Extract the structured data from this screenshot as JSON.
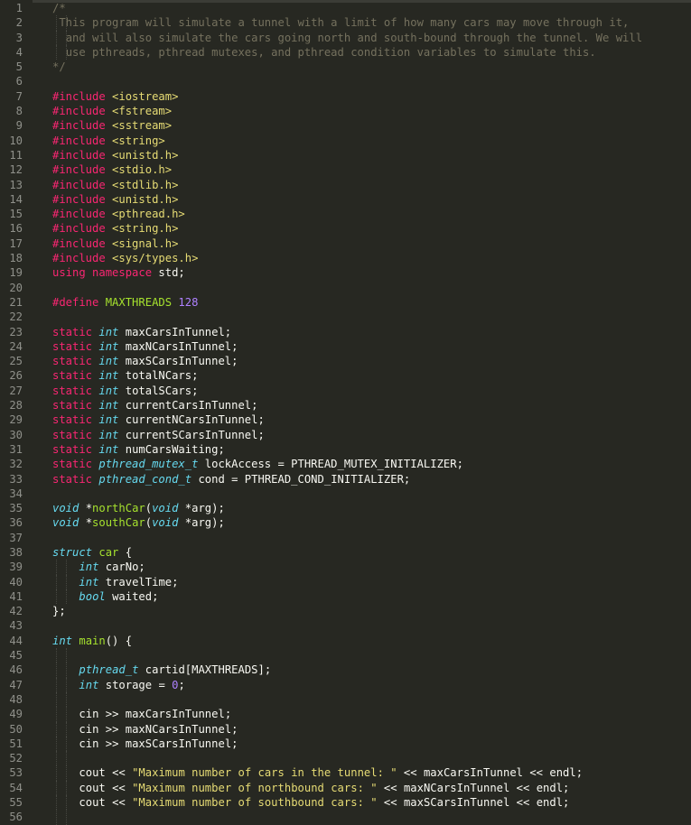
{
  "editor": {
    "theme_colors": {
      "background": "#272822",
      "comment": "#75715e",
      "keyword": "#f92672",
      "type": "#66d9ef",
      "function": "#a6e22e",
      "number": "#ae81ff",
      "string": "#e6db74",
      "text": "#f8f8f2",
      "line_number": "#8f908a"
    },
    "lines": [
      {
        "n": "1",
        "indent": 0,
        "tokens": [
          {
            "c": "comment",
            "t": "/*"
          }
        ]
      },
      {
        "n": "2",
        "indent": 1,
        "tokens": [
          {
            "c": "comment",
            "t": "This program will simulate a tunnel with a limit of how many cars may move through it,"
          }
        ]
      },
      {
        "n": "3",
        "indent": 2,
        "tokens": [
          {
            "c": "comment",
            "t": "and will also simulate the cars going north and south-bound through the tunnel. We will"
          }
        ]
      },
      {
        "n": "4",
        "indent": 2,
        "tokens": [
          {
            "c": "comment",
            "t": "use pthreads, pthread mutexes, and pthread condition variables to simulate this."
          }
        ]
      },
      {
        "n": "5",
        "indent": 0,
        "tokens": [
          {
            "c": "comment",
            "t": "*/"
          }
        ]
      },
      {
        "n": "6",
        "indent": 0,
        "tokens": []
      },
      {
        "n": "7",
        "indent": 0,
        "tokens": [
          {
            "c": "pre",
            "t": "#include "
          },
          {
            "c": "inc",
            "t": "<iostream>"
          }
        ]
      },
      {
        "n": "8",
        "indent": 0,
        "tokens": [
          {
            "c": "pre",
            "t": "#include "
          },
          {
            "c": "inc",
            "t": "<fstream>"
          }
        ]
      },
      {
        "n": "9",
        "indent": 0,
        "tokens": [
          {
            "c": "pre",
            "t": "#include "
          },
          {
            "c": "inc",
            "t": "<sstream>"
          }
        ]
      },
      {
        "n": "10",
        "indent": 0,
        "tokens": [
          {
            "c": "pre",
            "t": "#include "
          },
          {
            "c": "inc",
            "t": "<string>"
          }
        ]
      },
      {
        "n": "11",
        "indent": 0,
        "tokens": [
          {
            "c": "pre",
            "t": "#include "
          },
          {
            "c": "inc",
            "t": "<unistd.h>"
          }
        ]
      },
      {
        "n": "12",
        "indent": 0,
        "tokens": [
          {
            "c": "pre",
            "t": "#include "
          },
          {
            "c": "inc",
            "t": "<stdio.h>"
          }
        ]
      },
      {
        "n": "13",
        "indent": 0,
        "tokens": [
          {
            "c": "pre",
            "t": "#include "
          },
          {
            "c": "inc",
            "t": "<stdlib.h>"
          }
        ]
      },
      {
        "n": "14",
        "indent": 0,
        "tokens": [
          {
            "c": "pre",
            "t": "#include "
          },
          {
            "c": "inc",
            "t": "<unistd.h>"
          }
        ]
      },
      {
        "n": "15",
        "indent": 0,
        "tokens": [
          {
            "c": "pre",
            "t": "#include "
          },
          {
            "c": "inc",
            "t": "<pthread.h>"
          }
        ]
      },
      {
        "n": "16",
        "indent": 0,
        "tokens": [
          {
            "c": "pre",
            "t": "#include "
          },
          {
            "c": "inc",
            "t": "<string.h>"
          }
        ]
      },
      {
        "n": "17",
        "indent": 0,
        "tokens": [
          {
            "c": "pre",
            "t": "#include "
          },
          {
            "c": "inc",
            "t": "<signal.h>"
          }
        ]
      },
      {
        "n": "18",
        "indent": 0,
        "tokens": [
          {
            "c": "pre",
            "t": "#include "
          },
          {
            "c": "inc",
            "t": "<sys/types.h>"
          }
        ]
      },
      {
        "n": "19",
        "indent": 0,
        "tokens": [
          {
            "c": "kw",
            "t": "using"
          },
          {
            "c": "plain",
            "t": " "
          },
          {
            "c": "kw",
            "t": "namespace"
          },
          {
            "c": "plain",
            "t": " std;"
          }
        ]
      },
      {
        "n": "20",
        "indent": 0,
        "tokens": []
      },
      {
        "n": "21",
        "indent": 0,
        "tokens": [
          {
            "c": "pre",
            "t": "#define "
          },
          {
            "c": "macro",
            "t": "MAXTHREADS"
          },
          {
            "c": "plain",
            "t": " "
          },
          {
            "c": "num",
            "t": "128"
          }
        ]
      },
      {
        "n": "22",
        "indent": 0,
        "tokens": []
      },
      {
        "n": "23",
        "indent": 0,
        "tokens": [
          {
            "c": "kw",
            "t": "static"
          },
          {
            "c": "plain",
            "t": " "
          },
          {
            "c": "type",
            "t": "int"
          },
          {
            "c": "plain",
            "t": " maxCarsInTunnel;"
          }
        ]
      },
      {
        "n": "24",
        "indent": 0,
        "tokens": [
          {
            "c": "kw",
            "t": "static"
          },
          {
            "c": "plain",
            "t": " "
          },
          {
            "c": "type",
            "t": "int"
          },
          {
            "c": "plain",
            "t": " maxNCarsInTunnel;"
          }
        ]
      },
      {
        "n": "25",
        "indent": 0,
        "tokens": [
          {
            "c": "kw",
            "t": "static"
          },
          {
            "c": "plain",
            "t": " "
          },
          {
            "c": "type",
            "t": "int"
          },
          {
            "c": "plain",
            "t": " maxSCarsInTunnel;"
          }
        ]
      },
      {
        "n": "26",
        "indent": 0,
        "tokens": [
          {
            "c": "kw",
            "t": "static"
          },
          {
            "c": "plain",
            "t": " "
          },
          {
            "c": "type",
            "t": "int"
          },
          {
            "c": "plain",
            "t": " totalNCars;"
          }
        ]
      },
      {
        "n": "27",
        "indent": 0,
        "tokens": [
          {
            "c": "kw",
            "t": "static"
          },
          {
            "c": "plain",
            "t": " "
          },
          {
            "c": "type",
            "t": "int"
          },
          {
            "c": "plain",
            "t": " totalSCars;"
          }
        ]
      },
      {
        "n": "28",
        "indent": 0,
        "tokens": [
          {
            "c": "kw",
            "t": "static"
          },
          {
            "c": "plain",
            "t": " "
          },
          {
            "c": "type",
            "t": "int"
          },
          {
            "c": "plain",
            "t": " currentCarsInTunnel;"
          }
        ]
      },
      {
        "n": "29",
        "indent": 0,
        "tokens": [
          {
            "c": "kw",
            "t": "static"
          },
          {
            "c": "plain",
            "t": " "
          },
          {
            "c": "type",
            "t": "int"
          },
          {
            "c": "plain",
            "t": " currentNCarsInTunnel;"
          }
        ]
      },
      {
        "n": "30",
        "indent": 0,
        "tokens": [
          {
            "c": "kw",
            "t": "static"
          },
          {
            "c": "plain",
            "t": " "
          },
          {
            "c": "type",
            "t": "int"
          },
          {
            "c": "plain",
            "t": " currentSCarsInTunnel;"
          }
        ]
      },
      {
        "n": "31",
        "indent": 0,
        "tokens": [
          {
            "c": "kw",
            "t": "static"
          },
          {
            "c": "plain",
            "t": " "
          },
          {
            "c": "type",
            "t": "int"
          },
          {
            "c": "plain",
            "t": " numCarsWaiting;"
          }
        ]
      },
      {
        "n": "32",
        "indent": 0,
        "tokens": [
          {
            "c": "kw",
            "t": "static"
          },
          {
            "c": "plain",
            "t": " "
          },
          {
            "c": "type",
            "t": "pthread_mutex_t"
          },
          {
            "c": "plain",
            "t": " lockAccess = PTHREAD_MUTEX_INITIALIZER;"
          }
        ]
      },
      {
        "n": "33",
        "indent": 0,
        "tokens": [
          {
            "c": "kw",
            "t": "static"
          },
          {
            "c": "plain",
            "t": " "
          },
          {
            "c": "type",
            "t": "pthread_cond_t"
          },
          {
            "c": "plain",
            "t": " cond = PTHREAD_COND_INITIALIZER;"
          }
        ]
      },
      {
        "n": "34",
        "indent": 0,
        "tokens": []
      },
      {
        "n": "35",
        "indent": 0,
        "tokens": [
          {
            "c": "type",
            "t": "void"
          },
          {
            "c": "plain",
            "t": " *"
          },
          {
            "c": "fn",
            "t": "northCar"
          },
          {
            "c": "plain",
            "t": "("
          },
          {
            "c": "type",
            "t": "void"
          },
          {
            "c": "plain",
            "t": " *arg);"
          }
        ]
      },
      {
        "n": "36",
        "indent": 0,
        "tokens": [
          {
            "c": "type",
            "t": "void"
          },
          {
            "c": "plain",
            "t": " *"
          },
          {
            "c": "fn",
            "t": "southCar"
          },
          {
            "c": "plain",
            "t": "("
          },
          {
            "c": "type",
            "t": "void"
          },
          {
            "c": "plain",
            "t": " *arg);"
          }
        ]
      },
      {
        "n": "37",
        "indent": 0,
        "tokens": []
      },
      {
        "n": "38",
        "indent": 0,
        "tokens": [
          {
            "c": "type",
            "t": "struct"
          },
          {
            "c": "plain",
            "t": " "
          },
          {
            "c": "fn",
            "t": "car"
          },
          {
            "c": "plain",
            "t": " {"
          }
        ]
      },
      {
        "n": "39",
        "indent": 4,
        "tokens": [
          {
            "c": "type",
            "t": "int"
          },
          {
            "c": "plain",
            "t": " carNo;"
          }
        ]
      },
      {
        "n": "40",
        "indent": 4,
        "tokens": [
          {
            "c": "type",
            "t": "int"
          },
          {
            "c": "plain",
            "t": " travelTime;"
          }
        ]
      },
      {
        "n": "41",
        "indent": 4,
        "tokens": [
          {
            "c": "type",
            "t": "bool"
          },
          {
            "c": "plain",
            "t": " waited;"
          }
        ]
      },
      {
        "n": "42",
        "indent": 0,
        "tokens": [
          {
            "c": "plain",
            "t": "};"
          }
        ]
      },
      {
        "n": "43",
        "indent": 0,
        "tokens": []
      },
      {
        "n": "44",
        "indent": 0,
        "tokens": [
          {
            "c": "type",
            "t": "int"
          },
          {
            "c": "plain",
            "t": " "
          },
          {
            "c": "fn",
            "t": "main"
          },
          {
            "c": "plain",
            "t": "() {"
          }
        ]
      },
      {
        "n": "45",
        "indent": 4,
        "tokens": []
      },
      {
        "n": "46",
        "indent": 4,
        "tokens": [
          {
            "c": "type",
            "t": "pthread_t"
          },
          {
            "c": "plain",
            "t": " cartid[MAXTHREADS];"
          }
        ]
      },
      {
        "n": "47",
        "indent": 4,
        "tokens": [
          {
            "c": "type",
            "t": "int"
          },
          {
            "c": "plain",
            "t": " storage = "
          },
          {
            "c": "num",
            "t": "0"
          },
          {
            "c": "plain",
            "t": ";"
          }
        ]
      },
      {
        "n": "48",
        "indent": 4,
        "tokens": []
      },
      {
        "n": "49",
        "indent": 4,
        "tokens": [
          {
            "c": "plain",
            "t": "cin >> maxCarsInTunnel;"
          }
        ]
      },
      {
        "n": "50",
        "indent": 4,
        "tokens": [
          {
            "c": "plain",
            "t": "cin >> maxNCarsInTunnel;"
          }
        ]
      },
      {
        "n": "51",
        "indent": 4,
        "tokens": [
          {
            "c": "plain",
            "t": "cin >> maxSCarsInTunnel;"
          }
        ]
      },
      {
        "n": "52",
        "indent": 4,
        "tokens": []
      },
      {
        "n": "53",
        "indent": 4,
        "tokens": [
          {
            "c": "plain",
            "t": "cout << "
          },
          {
            "c": "str",
            "t": "\"Maximum number of cars in the tunnel: \""
          },
          {
            "c": "plain",
            "t": " << maxCarsInTunnel << endl;"
          }
        ]
      },
      {
        "n": "54",
        "indent": 4,
        "tokens": [
          {
            "c": "plain",
            "t": "cout << "
          },
          {
            "c": "str",
            "t": "\"Maximum number of northbound cars: \""
          },
          {
            "c": "plain",
            "t": " << maxNCarsInTunnel << endl;"
          }
        ]
      },
      {
        "n": "55",
        "indent": 4,
        "tokens": [
          {
            "c": "plain",
            "t": "cout << "
          },
          {
            "c": "str",
            "t": "\"Maximum number of southbound cars: \""
          },
          {
            "c": "plain",
            "t": " << maxSCarsInTunnel << endl;"
          }
        ]
      },
      {
        "n": "56",
        "indent": 4,
        "tokens": []
      }
    ]
  }
}
